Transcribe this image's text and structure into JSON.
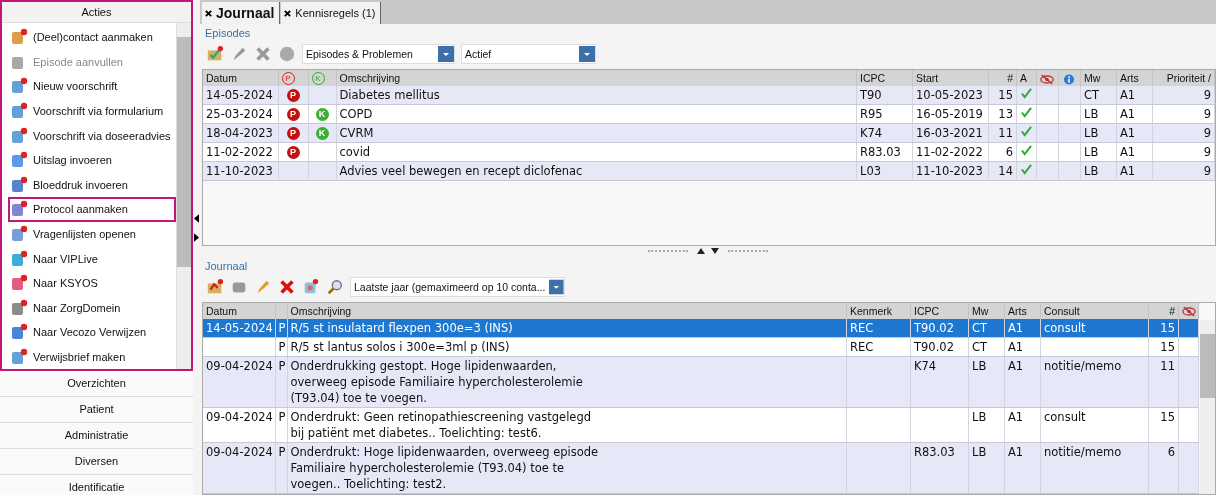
{
  "sidebar": {
    "highlighted": true,
    "sections_top": [
      {
        "label": "Acties",
        "expanded": true
      }
    ],
    "items": [
      {
        "label": "(Deel)contact aanmaken",
        "disabled": false,
        "highlighted": false
      },
      {
        "label": "Episode aanvullen",
        "disabled": true,
        "highlighted": false
      },
      {
        "label": "Nieuw voorschrift",
        "disabled": false,
        "highlighted": false
      },
      {
        "label": "Voorschrift via formularium",
        "disabled": false,
        "highlighted": false
      },
      {
        "label": "Voorschrift via doseeradvies",
        "disabled": false,
        "highlighted": false
      },
      {
        "label": "Uitslag invoeren",
        "disabled": false,
        "highlighted": false
      },
      {
        "label": "Bloeddruk invoeren",
        "disabled": false,
        "highlighted": false
      },
      {
        "label": "Protocol aanmaken",
        "disabled": false,
        "highlighted": true
      },
      {
        "label": "Vragenlijsten openen",
        "disabled": false,
        "highlighted": false
      },
      {
        "label": "Naar VIPLive",
        "disabled": false,
        "highlighted": false
      },
      {
        "label": "Naar KSYOS",
        "disabled": false,
        "highlighted": false
      },
      {
        "label": "Naar ZorgDomein",
        "disabled": false,
        "highlighted": false
      },
      {
        "label": "Naar Vecozo Verwijzen",
        "disabled": false,
        "highlighted": false
      },
      {
        "label": "Verwijsbrief maken",
        "disabled": false,
        "highlighted": false
      }
    ],
    "sections": [
      "Overzichten",
      "Patient",
      "Administratie",
      "Diversen",
      "Identificatie"
    ]
  },
  "tabs": [
    {
      "label": "Journaal",
      "selected": true
    },
    {
      "label": "Kennisregels (1)",
      "selected": false
    }
  ],
  "episodes": {
    "title": "Episodes",
    "filter": "Episodes & Problemen",
    "status": "Actief",
    "columns": [
      {
        "label": "Datum",
        "kind": "text"
      },
      {
        "label": "P",
        "kind": "badge"
      },
      {
        "label": "K",
        "kind": "badge"
      },
      {
        "label": "Omschrijving",
        "kind": "text"
      },
      {
        "label": "ICPC",
        "kind": "text"
      },
      {
        "label": "Start",
        "kind": "text"
      },
      {
        "label": "#",
        "kind": "num"
      },
      {
        "label": "A",
        "kind": "text"
      },
      {
        "kind": "hidden-icon"
      },
      {
        "kind": "info-icon"
      },
      {
        "label": "Mw",
        "kind": "text"
      },
      {
        "label": "Arts",
        "kind": "text"
      },
      {
        "label": "Prioriteit /",
        "kind": "num"
      }
    ],
    "rows": [
      {
        "datum": "14-05-2024",
        "p": "P",
        "omschrijving": "Diabetes mellitus",
        "icpc": "T90",
        "start": "10-05-2023",
        "count": "15",
        "active": true,
        "mw": "CT",
        "arts": "A1",
        "prioriteit": "9"
      },
      {
        "datum": "25-03-2024",
        "p": "P",
        "k": "K",
        "omschrijving": "COPD",
        "icpc": "R95",
        "start": "16-05-2019",
        "count": "13",
        "active": true,
        "mw": "LB",
        "arts": "A1",
        "prioriteit": "9"
      },
      {
        "datum": "18-04-2023",
        "p": "P",
        "k": "K",
        "omschrijving": "CVRM",
        "icpc": "K74",
        "start": "16-03-2021",
        "count": "11",
        "active": true,
        "mw": "LB",
        "arts": "A1",
        "prioriteit": "9"
      },
      {
        "datum": "11-02-2022",
        "p": "P",
        "omschrijving": "covid",
        "icpc": "R83.03",
        "start": "11-02-2022",
        "count": "6",
        "active": true,
        "mw": "LB",
        "arts": "A1",
        "prioriteit": "9"
      },
      {
        "datum": "11-10-2023",
        "omschrijving": "Advies veel bewegen en recept diclofenac",
        "icpc": "L03",
        "start": "11-10-2023",
        "count": "14",
        "active": true,
        "mw": "LB",
        "arts": "A1",
        "prioriteit": "9"
      }
    ]
  },
  "journal": {
    "title": "Journaal",
    "filter": "Laatste jaar (gemaximeerd op 10 conta...",
    "columns": [
      "Datum",
      "",
      "Omschrijving",
      "Kenmerk",
      "ICPC",
      "Mw",
      "Arts",
      "Consult",
      "#"
    ],
    "rows": [
      {
        "datum": "14-05-2024",
        "type": "P",
        "omschrijving": "R/5 st insulatard flexpen 300e=3 (INS)",
        "kenmerk": "REC",
        "icpc": "T90.02",
        "mw": "CT",
        "arts": "A1",
        "consult": "consult",
        "count": "15",
        "selected": true
      },
      {
        "type": "P",
        "omschrijving": "R/5 st lantus solos i 300e=3ml p (INS)",
        "kenmerk": "REC",
        "icpc": "T90.02",
        "mw": "CT",
        "arts": "A1",
        "count": "15",
        "selected": false
      },
      {
        "datum": "09-04-2024",
        "type": "P",
        "omschrijving": "Onderdrukking gestopt. Hoge lipidenwaarden,\noverweeg episode Familiaire hypercholesterolemie\n(T93.04) toe te voegen.",
        "icpc": "K74",
        "mw": "LB",
        "arts": "A1",
        "consult": "notitie/memo",
        "count": "11",
        "selected": false
      },
      {
        "datum": "09-04-2024",
        "type": "P",
        "omschrijving": "Onderdrukt: Geen retinopathiescreening vastgelegd\nbij patiënt met diabetes.. Toelichting: test6.",
        "mw": "LB",
        "arts": "A1",
        "consult": "consult",
        "count": "15",
        "selected": false
      },
      {
        "datum": "09-04-2024",
        "type": "P",
        "omschrijving": "Onderdrukt: Hoge lipidenwaarden, overweeg episode\nFamiliaire hypercholesterolemie (T93.04) toe te\nvoegen.. Toelichting: test2.",
        "icpc": "R83.03",
        "mw": "LB",
        "arts": "A1",
        "consult": "notitie/memo",
        "count": "6",
        "selected": false
      }
    ]
  }
}
